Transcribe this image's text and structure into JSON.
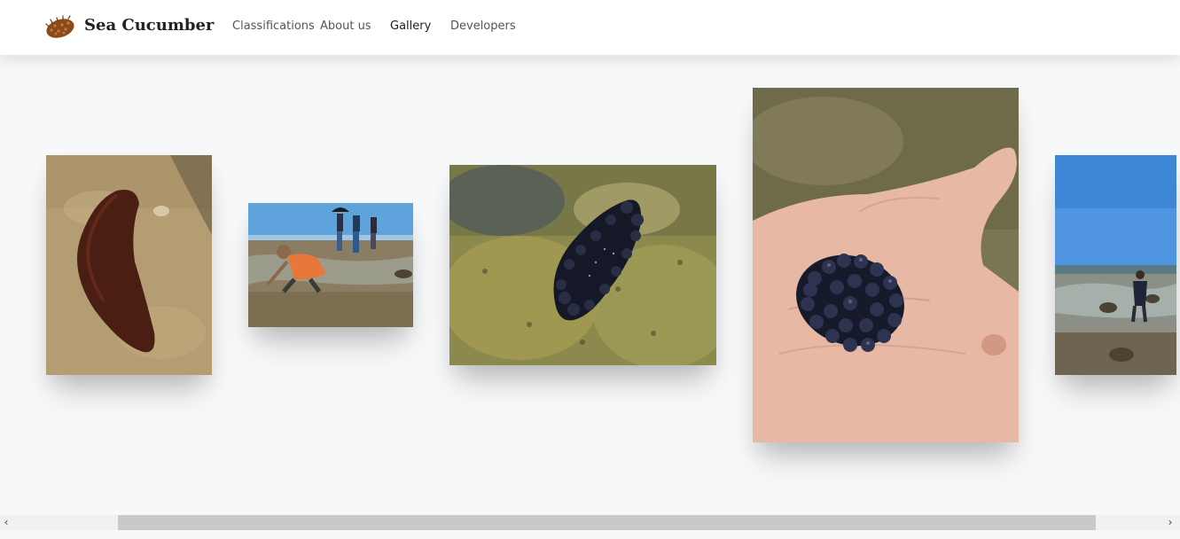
{
  "brand": {
    "name": "Sea Cucumber",
    "logo": "sea-cucumber-logo-icon"
  },
  "nav": {
    "items": [
      {
        "label": "Classifications",
        "active": false
      },
      {
        "label": "About us",
        "active": false
      },
      {
        "label": "Gallery",
        "active": true
      },
      {
        "label": "Developers",
        "active": false
      }
    ]
  },
  "gallery": {
    "photos": [
      {
        "subject": "sea cucumber on sandy seabed"
      },
      {
        "subject": "people searching tide pools on rocky shore"
      },
      {
        "subject": "dark bumpy sea cucumber on mossy rock"
      },
      {
        "subject": "small black knobby creature held in palm"
      },
      {
        "subject": "person wading in shallow rocky shore"
      }
    ]
  },
  "scrollbar": {
    "left_arrow": "‹",
    "right_arrow": "›"
  },
  "colors": {
    "background": "#f7f8fa",
    "navbar": "#ffffff",
    "scroll_thumb": "#c9c9c9"
  }
}
